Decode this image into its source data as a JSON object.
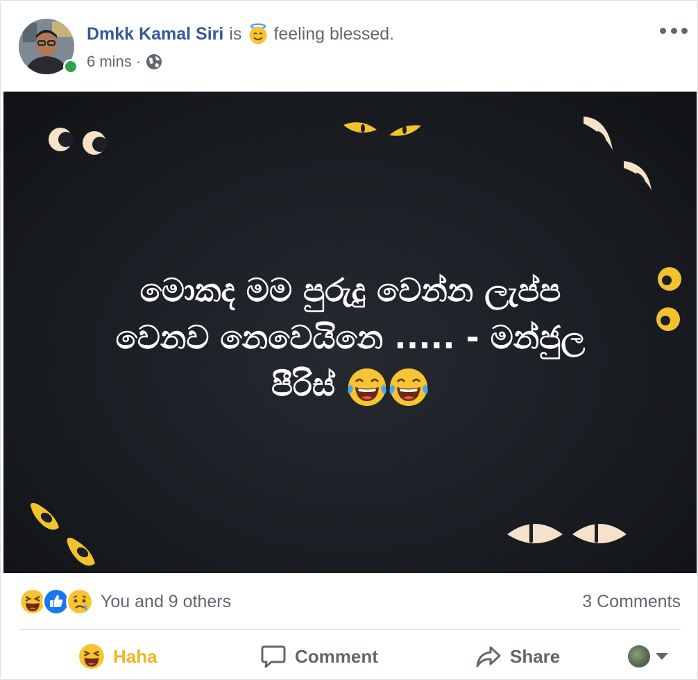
{
  "post": {
    "author": "Dmkk Kamal Siri",
    "is_word": "is",
    "feeling_icon": "halo-smile-emoji",
    "feeling_text": "feeling blessed.",
    "timestamp": "6 mins",
    "separator": "·",
    "privacy_icon": "globe-icon",
    "online": true
  },
  "image": {
    "text_line1": "මොකද මම පුරුදු වෙන්න ලැප්ප",
    "text_line2": "වෙනව නෙවෙයිනෙ ..... - මන්ජුල",
    "text_line3": "පීරිස්",
    "emoji": "tears-of-joy-emoji"
  },
  "reactions": {
    "icons": [
      "haha-reaction-icon",
      "like-reaction-icon",
      "sad-reaction-icon"
    ],
    "summary": "You and 9 others",
    "comments": "3 Comments"
  },
  "actions": {
    "haha_label": "Haha",
    "comment_label": "Comment",
    "share_label": "Share"
  },
  "colors": {
    "author_link": "#385898",
    "haha_active": "#f7b125",
    "like_blue": "#1877f2",
    "online_green": "#31a24c",
    "eye_yellow": "#f3c22f",
    "eye_cream": "#f5e2c8"
  }
}
